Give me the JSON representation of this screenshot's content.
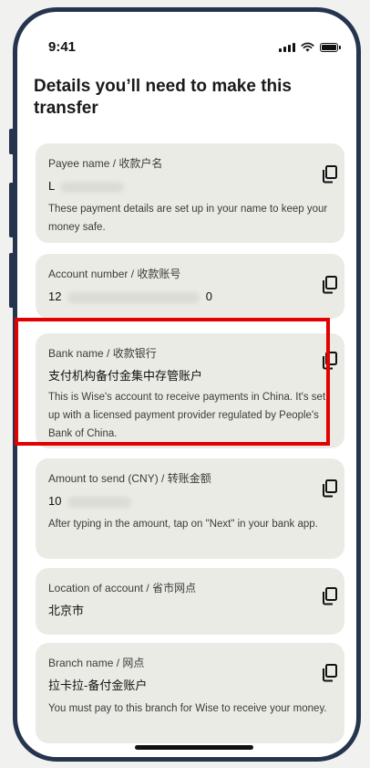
{
  "status_bar": {
    "time": "9:41"
  },
  "page": {
    "title": "Details you’ll need to make this transfer"
  },
  "cards": [
    {
      "label": "Payee name / 收款户名",
      "value": "L",
      "desc": "These payment details are set up in your name to keep your money safe."
    },
    {
      "label": "Account number / 收款账号",
      "value_start": "12",
      "value_end": "0"
    },
    {
      "label": "Bank name / 收款银行",
      "value": "支付机构备付金集中存管账户",
      "desc": "This is Wise's account to receive payments in China. It's set up with a licensed payment provider regulated by People's Bank of China."
    },
    {
      "label": "Amount to send (CNY) / 转账金额",
      "value": "10",
      "desc": "After typing in the amount, tap on \"Next\" in your bank app."
    },
    {
      "label": "Location of account / 省市网点",
      "value": "北京市"
    },
    {
      "label": "Branch name / 网点",
      "value": "拉卡拉-备付金账户",
      "desc": "You must pay to this branch for Wise to receive your money."
    }
  ],
  "colors": {
    "frame": "#26344e",
    "card_bg": "#ebebe6",
    "highlight": "#e20000"
  },
  "icons": {
    "copy": "copy-icon"
  }
}
